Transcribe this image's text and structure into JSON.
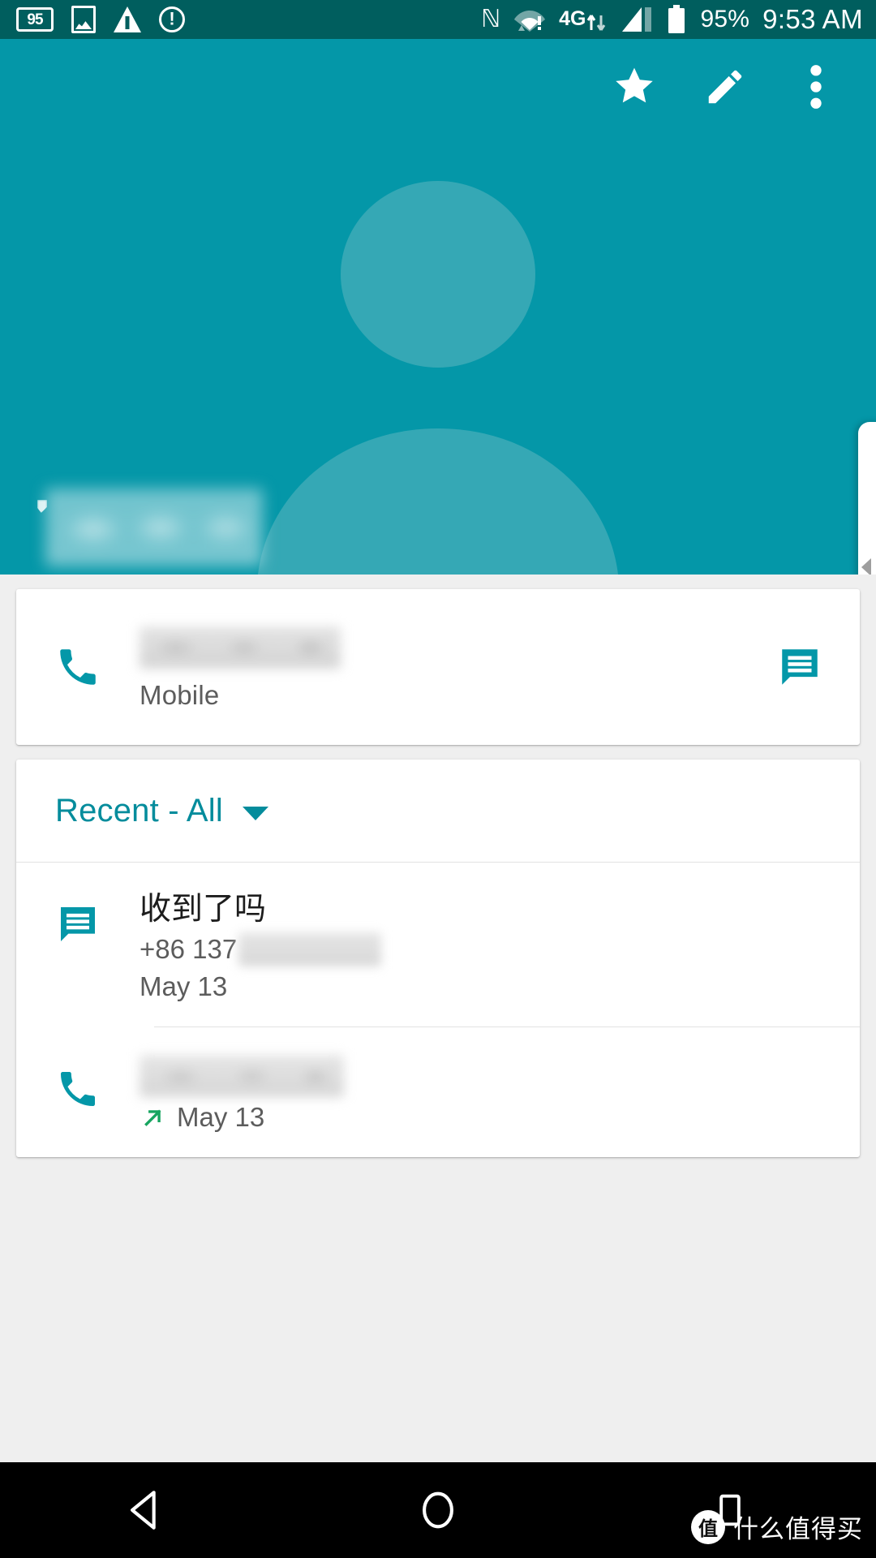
{
  "status_bar": {
    "left_icons": [
      "speed-badge-icon",
      "image-icon",
      "warning-triangle-icon",
      "exclamation-circle-icon"
    ],
    "speed_badge": "95",
    "nfc_icon": "nfc-icon",
    "wifi_icon": "wifi-alert-icon",
    "network_label": "4G",
    "network_icon": "data-transfer-icon",
    "signal_icon": "signal-bars-icon",
    "battery_icon": "battery-icon",
    "battery_percent": "95%",
    "time": "9:53 AM",
    "background_color": "#005e5e",
    "foreground_color": "#ffffff"
  },
  "app_bar": {
    "actions": [
      {
        "name": "favorite-star-button",
        "icon": "star-icon"
      },
      {
        "name": "edit-contact-button",
        "icon": "pencil-icon"
      },
      {
        "name": "overflow-menu-button",
        "icon": "more-vert-icon"
      }
    ],
    "background_color": "#0497a8",
    "avatar_color": "#35a8b5"
  },
  "contact": {
    "name_redacted": true,
    "avatar_placeholder": "person-silhouette-icon"
  },
  "phone_card": {
    "call_icon": "phone-icon",
    "number_redacted": true,
    "type_label": "Mobile",
    "message_icon": "message-icon"
  },
  "recent_section": {
    "filter_label": "Recent - All",
    "dropdown_icon": "chevron-down-icon",
    "entries": [
      {
        "kind": "sms",
        "icon": "message-icon",
        "title": "收到了吗",
        "number_prefix": "+86 137",
        "number_redacted": true,
        "date": "May 13"
      },
      {
        "kind": "call",
        "icon": "phone-icon",
        "title_redacted": true,
        "direction_icon": "outgoing-call-arrow-icon",
        "direction_color": "#17a560",
        "date": "May 13"
      }
    ]
  },
  "nav_bar": {
    "back": "back-triangle-icon",
    "home": "home-circle-icon",
    "recents": "recents-square-icon",
    "background_color": "#000000"
  },
  "watermark": {
    "badge": "值",
    "text": "什么值得买"
  },
  "theme": {
    "accent": "#0497a8",
    "accent_dark": "#005e5e",
    "link": "#048c9c",
    "surface": "#ffffff",
    "background": "#efefef"
  }
}
